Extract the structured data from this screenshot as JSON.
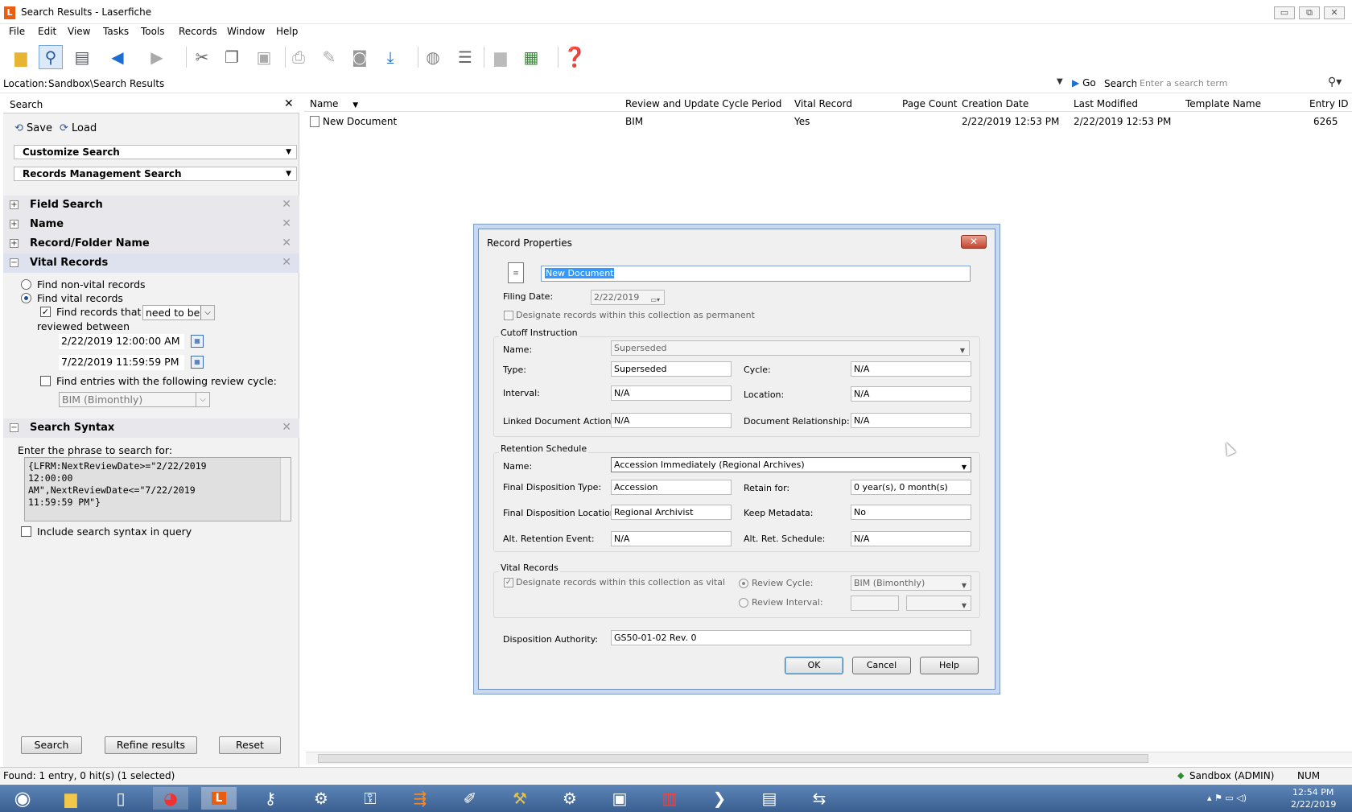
{
  "window": {
    "title": "Search Results - Laserfiche",
    "logo": "L",
    "min": "▭",
    "max": "⧉",
    "close": "✕"
  },
  "menu": [
    "File",
    "Edit",
    "View",
    "Tasks",
    "Tools",
    "Records",
    "Window",
    "Help"
  ],
  "toolbar_icons": [
    "folder-icon",
    "search-icon",
    "browse-panel-icon",
    "back-arrow-icon",
    "forward-arrow-icon",
    "scissors-icon",
    "copy-icon",
    "paste-icon",
    "print-icon",
    "pen-icon",
    "camera-icon",
    "download-icon",
    "metadata-icon",
    "fields-icon",
    "folder-icon",
    "thumbnails-icon",
    "help-icon"
  ],
  "location": {
    "label": "Location:",
    "value": "Sandbox\\Search Results",
    "go": "Go",
    "search_label": "Search:",
    "search_placeholder": "Enter a search term"
  },
  "left_panel": {
    "title": "Search",
    "save": "Save",
    "load": "Load",
    "customize": "Customize Search",
    "records_mgmt": "Records Management Search",
    "sections": [
      {
        "label": "Field Search",
        "exp": "+"
      },
      {
        "label": "Name",
        "exp": "+"
      },
      {
        "label": "Record/Folder Name",
        "exp": "+"
      },
      {
        "label": "Vital Records",
        "exp": "−"
      }
    ],
    "vital": {
      "opt1": "Find non-vital records",
      "opt2": "Find vital records",
      "chk_label": "Find records that",
      "need_value": "need to be",
      "reviewed": "reviewed between",
      "date1": "2/22/2019 12:00:00 AM",
      "date2": "7/22/2019 11:59:59 PM",
      "cycle_label": "Find entries with the following review cycle:",
      "cycle_value": "BIM (Bimonthly)"
    },
    "syntax": {
      "section": "Search Syntax",
      "exp": "−",
      "prompt": "Enter the phrase to search for:",
      "text": "{LFRM:NextReviewDate>=\"2/22/2019\n12:00:00\nAM\",NextReviewDate<=\"7/22/2019\n11:59:59 PM\"}",
      "include": "Include search syntax in query"
    },
    "buttons": {
      "search": "Search",
      "refine": "Refine results",
      "reset": "Reset"
    }
  },
  "results": {
    "columns": [
      "Name",
      "Review and Update Cycle Period",
      "Vital Record",
      "Page Count",
      "Creation Date",
      "Last Modified",
      "Template Name",
      "Entry ID"
    ],
    "rows": [
      {
        "name": "New Document",
        "cycle": "BIM",
        "vital": "Yes",
        "pages": "",
        "created": "2/22/2019 12:53 PM",
        "modified": "2/22/2019 12:53 PM",
        "template": "",
        "id": "6265"
      }
    ]
  },
  "status": {
    "left": "Found: 1 entry, 0 hit(s) (1 selected)",
    "db": "Sandbox (ADMIN)",
    "num": "NUM"
  },
  "clock": {
    "time": "12:54 PM",
    "date": "2/22/2019"
  },
  "dialog": {
    "title": "Record Properties",
    "doc_name": "New Document",
    "filing_date_label": "Filing Date:",
    "filing_date": "2/22/2019",
    "permanent": "Designate records within this collection as permanent",
    "cutoff": {
      "group": "Cutoff Instruction",
      "name_label": "Name:",
      "name": "Superseded",
      "type_label": "Type:",
      "type": "Superseded",
      "cycle_label": "Cycle:",
      "cycle": "N/A",
      "interval_label": "Interval:",
      "interval": "N/A",
      "location_label": "Location:",
      "location": "N/A",
      "linked_label": "Linked Document Action:",
      "linked": "N/A",
      "relationship_label": "Document Relationship:",
      "relationship": "N/A"
    },
    "retention": {
      "group": "Retention Schedule",
      "name_label": "Name:",
      "name": "Accession Immediately (Regional Archives)",
      "fdt_label": "Final Disposition Type:",
      "fdt": "Accession",
      "retain_label": "Retain for:",
      "retain": "0 year(s), 0 month(s)",
      "fdl_label": "Final Disposition Location:",
      "fdl": "Regional Archivist",
      "keep_label": "Keep Metadata:",
      "keep": "No",
      "alt_event_label": "Alt. Retention Event:",
      "alt_event": "N/A",
      "alt_sched_label": "Alt. Ret. Schedule:",
      "alt_sched": "N/A"
    },
    "vital": {
      "group": "Vital Records",
      "designate": "Designate records within this collection as vital",
      "review_cycle_label": "Review Cycle:",
      "review_cycle": "BIM (Bimonthly)",
      "review_interval_label": "Review Interval:"
    },
    "authority_label": "Disposition Authority:",
    "authority": "GS50-01-02 Rev. 0",
    "ok": "OK",
    "cancel": "Cancel",
    "help": "Help"
  }
}
